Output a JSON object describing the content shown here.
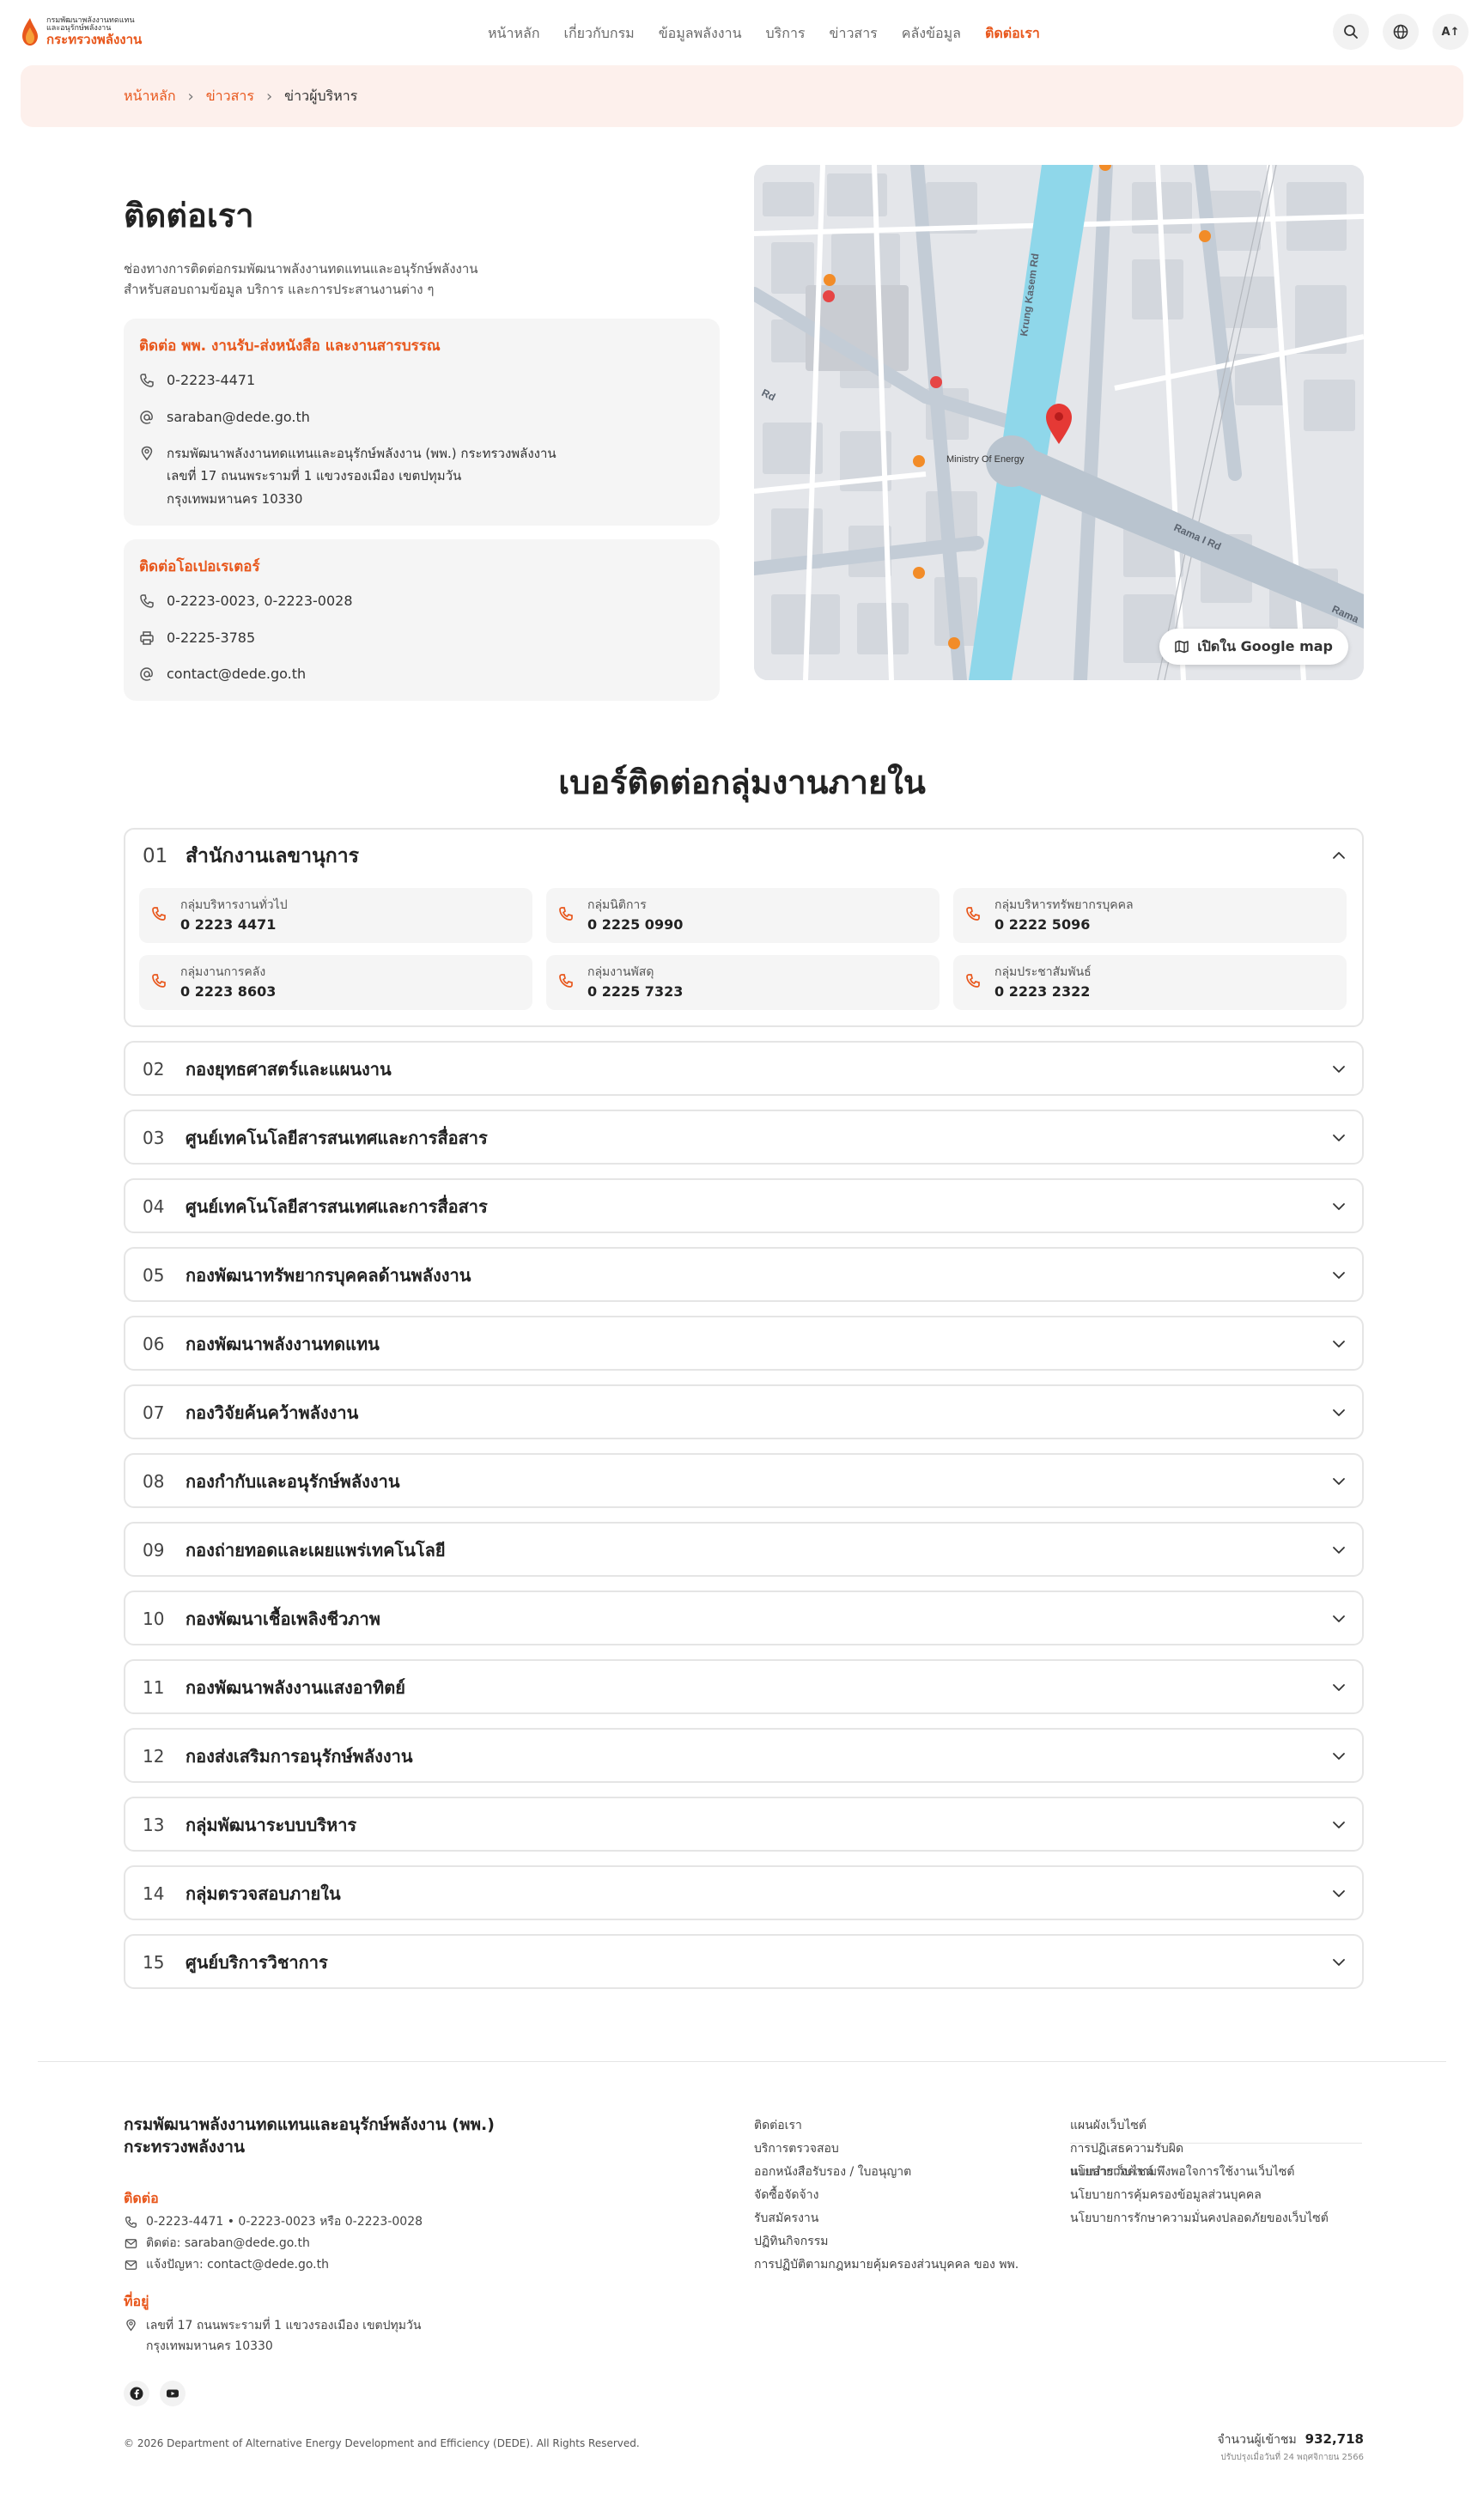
{
  "header": {
    "logo_line1": "กรมพัฒนาพลังงานทดแทน",
    "logo_line2": "และอนุรักษ์พลังงาน",
    "logo_line3": "กระทรวงพลังงาน",
    "nav": [
      "หน้าหลัก",
      "เกี่ยวกับกรม",
      "ข้อมูลพลังงาน",
      "บริการ",
      "ข่าวสาร",
      "คลังข้อมูล",
      "ติดต่อเรา"
    ],
    "font_size_label": "A↑",
    "icons": [
      "search-icon",
      "globe-icon",
      "font-size-icon"
    ]
  },
  "breadcrumb": {
    "home": "หน้าหลัก",
    "section": "ข่าวสาร",
    "current": "ข่าวผู้บริหาร"
  },
  "contact": {
    "title": "ติดต่อเรา",
    "subtitle": "ช่องทางการติดต่อกรมพัฒนาพลังงานทดแทนและอนุรักษ์พลังงาน สำหรับสอบถามข้อมูล บริการ และการประสานงานต่าง ๆ",
    "saraban": {
      "title": "ติดต่อ พพ. งานรับ-ส่งหนังสือ และงานสารบรรณ",
      "phone": "0-2223-4471",
      "email": "saraban@dede.go.th",
      "address_line1": "กรมพัฒนาพลังงานทดแทนและอนุรักษ์พลังงาน (พพ.) กระทรวงพลังงาน",
      "address_line2": "เลขที่ 17 ถนนพระรามที่ 1 แขวงรองเมือง เขตปทุมวัน",
      "address_line3": "กรุงเทพมหานคร 10330"
    },
    "operator": {
      "title": "ติดต่อโอเปอเรเตอร์",
      "phone": "0-2223-0023, 0-2223-0028",
      "fax": "0-2225-3785",
      "email": "contact@dede.go.th"
    }
  },
  "map": {
    "road1": "Krung Kasem Rd",
    "road2": "Rama I Rd",
    "road3": "Rama",
    "road4": "Rd",
    "landmark": "Ministry Of Energy",
    "button_label": "เปิดใน Google map"
  },
  "departments": {
    "title": "เบอร์ติดต่อกลุ่มงานภายใน",
    "items": [
      {
        "num": "01",
        "name": "สำนักงานเลขานุการ",
        "open": true,
        "contacts": [
          {
            "label": "กลุ่มบริหารงานทั่วไป",
            "phone": "0 2223 4471"
          },
          {
            "label": "กลุ่มนิติการ",
            "phone": "0 2225 0990"
          },
          {
            "label": "กลุ่มบริหารทรัพยากรบุคคล",
            "phone": "0 2222 5096"
          },
          {
            "label": "กลุ่มงานการคลัง",
            "phone": "0 2223 8603"
          },
          {
            "label": "กลุ่มงานพัสดุ",
            "phone": "0 2225 7323"
          },
          {
            "label": "กลุ่มประชาสัมพันธ์",
            "phone": "0 2223 2322"
          }
        ]
      },
      {
        "num": "02",
        "name": "กองยุทธศาสตร์และแผนงาน"
      },
      {
        "num": "03",
        "name": "ศูนย์เทคโนโลยีสารสนเทศและการสื่อสาร"
      },
      {
        "num": "04",
        "name": "ศูนย์เทคโนโลยีสารสนเทศและการสื่อสาร"
      },
      {
        "num": "05",
        "name": "กองพัฒนาทรัพยากรบุคคลด้านพลังงาน"
      },
      {
        "num": "06",
        "name": "กองพัฒนาพลังงานทดแทน"
      },
      {
        "num": "07",
        "name": "กองวิจัยค้นคว้าพลังงาน"
      },
      {
        "num": "08",
        "name": "กองกำกับและอนุรักษ์พลังงาน"
      },
      {
        "num": "09",
        "name": "กองถ่ายทอดและเผยแพร่เทคโนโลยี"
      },
      {
        "num": "10",
        "name": "กองพัฒนาเชื้อเพลิงชีวภาพ"
      },
      {
        "num": "11",
        "name": "กองพัฒนาพลังงานแสงอาทิตย์"
      },
      {
        "num": "12",
        "name": "กองส่งเสริมการอนุรักษ์พลังงาน"
      },
      {
        "num": "13",
        "name": "กลุ่มพัฒนาระบบบริหาร"
      },
      {
        "num": "14",
        "name": "กลุ่มตรวจสอบภายใน"
      },
      {
        "num": "15",
        "name": "ศูนย์บริการวิชาการ"
      }
    ]
  },
  "footer": {
    "org_line1": "กรมพัฒนาพลังงานทดแทนและอนุรักษ์พลังงาน (พพ.)",
    "org_line2": "กระทรวงพลังงาน",
    "contact_heading": "ติดต่อ",
    "phones": "0-2223-4471 • 0-2223-0023 หรือ 0-2223-0028",
    "email_saraban": "ติดต่อ: saraban@dede.go.th",
    "email_contact": "แจ้งปัญหา: contact@dede.go.th",
    "location_heading": "ที่อยู่",
    "address_line1": "เลขที่ 17 ถนนพระรามที่ 1 แขวงรองเมือง เขตปทุมวัน",
    "address_line2": "กรุงเทพมหานคร 10330",
    "links_col1": [
      "ติดต่อเรา",
      "บริการตรวจสอบ",
      "ออกหนังสือรับรอง / ใบอนุญาต",
      "จัดซื้อจัดจ้าง",
      "รับสมัครงาน",
      "ปฏิทินกิจกรรม",
      "การปฏิบัติตามกฎหมายคุ้มครองส่วนบุคคล ของ พพ."
    ],
    "links_col2_a": [
      "แผนผังเว็บไซต์",
      "การปฏิเสธความรับผิด",
      "แบบสำรวจความพึงพอใจการใช้งานเว็บไซต์"
    ],
    "links_col2_b": [
      "นโยบายเว็บไซต์",
      "นโยบายการคุ้มครองข้อมูลส่วนบุคคล",
      "นโยบายการรักษาความมั่นคงปลอดภัยของเว็บไซต์"
    ],
    "copyright": "© 2026 Department of Alternative Energy Development and Efficiency (DEDE). All Rights Reserved.",
    "visitors_label": "จำนวนผู้เข้าชม",
    "visitors_count": "932,718",
    "updated": "ปรับปรุงเมื่อวันที่ 24 พฤศจิกายน 2566"
  },
  "colors": {
    "accent": "#e8571c",
    "breadcrumb_bg": "#fdf0ec",
    "card_bg": "#f5f5f5",
    "map_canal": "#8fd7ea",
    "map_road": "#b9c4cf"
  }
}
